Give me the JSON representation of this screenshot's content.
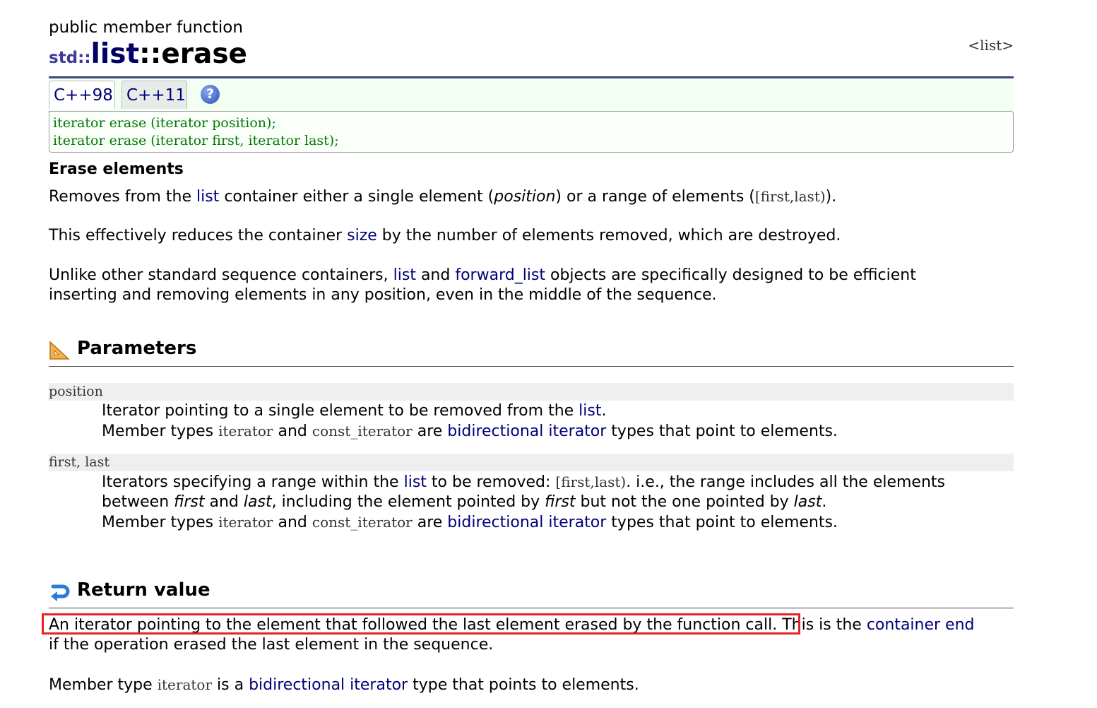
{
  "header": {
    "kind": "public member function",
    "namespace": "std::",
    "class_name": "list",
    "sep": "::",
    "member": "erase",
    "header_link": "<list>"
  },
  "tabs": [
    {
      "label": "C++98"
    },
    {
      "label": "C++11"
    }
  ],
  "help_icon": "?",
  "prototypes": [
    "iterator erase (iterator position);",
    "iterator erase (iterator first, iterator last);"
  ],
  "summary": {
    "heading": "Erase elements",
    "p1": {
      "a": "Removes from the ",
      "link_list": "list",
      "b": " container either a single element (",
      "position": "position",
      "c": ") or a range of elements (",
      "range": "[first,last)",
      "d": ")."
    },
    "p2": {
      "a": "This effectively reduces the container ",
      "link_size": "size",
      "b": " by the number of elements removed, which are destroyed."
    },
    "p3": {
      "a": "Unlike other standard sequence containers, ",
      "link_list": "list",
      "b": " and ",
      "link_forward_list": "forward_list",
      "c": " objects are specifically designed to be efficient",
      "d": "inserting and removing elements in any position, even in the middle of the sequence."
    }
  },
  "parameters": {
    "heading": "Parameters",
    "position": {
      "name": "position",
      "l1a": "Iterator pointing to a single element to be removed from the ",
      "l1link": "list",
      "l1b": ".",
      "l2a": "Member types ",
      "l2code1": "iterator",
      "l2b": " and ",
      "l2code2": "const_iterator",
      "l2c": " are ",
      "l2link": "bidirectional iterator",
      "l2d": " types that point to elements."
    },
    "range": {
      "name": "first, last",
      "l1a": "Iterators specifying a range within the ",
      "l1link": "list",
      "l1b": " to be removed: ",
      "l1code": "[first,last)",
      "l1c": ". i.e., the range includes all the elements",
      "l2a": "between ",
      "l2first": "first",
      "l2b": " and ",
      "l2last": "last",
      "l2c": ", including the element pointed by ",
      "l2first2": "first",
      "l2d": " but not the one pointed by ",
      "l2last2": "last",
      "l2e": ".",
      "l3a": "Member types ",
      "l3code1": "iterator",
      "l3b": " and ",
      "l3code2": "const_iterator",
      "l3c": " are ",
      "l3link": "bidirectional iterator",
      "l3d": " types that point to elements."
    }
  },
  "return_value": {
    "heading": "Return value",
    "l1a": "An iterator pointing to the element that followed the last element erased by the function call.",
    "l1b": " This is the ",
    "l1link": "container end",
    "l2": "if the operation erased the last element in the sequence.",
    "p2a": "Member type ",
    "p2code": "iterator",
    "p2b": " is a ",
    "p2link": "bidirectional iterator",
    "p2c": " type that points to elements."
  }
}
